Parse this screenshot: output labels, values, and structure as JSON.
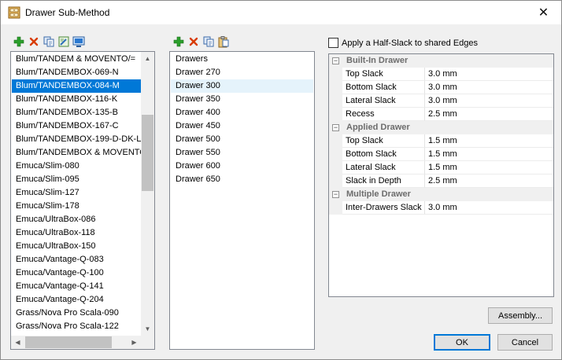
{
  "window": {
    "title": "Drawer Sub-Method",
    "close_glyph": "✕"
  },
  "icons": {
    "app": "drawer-cabinet-icon",
    "add": "add-icon",
    "delete": "delete-icon",
    "copy": "copy-icon",
    "edit": "edit-icon",
    "preview": "preview-icon",
    "paste": "paste-icon"
  },
  "colors": {
    "selection": "#0078d7",
    "add_green": "#2ca02c",
    "delete_red": "#d83b01"
  },
  "methods": {
    "items": [
      "Blum/TANDEM & MOVENTO/=",
      "Blum/TANDEMBOX-069-N",
      "Blum/TANDEMBOX-084-M",
      "Blum/TANDEMBOX-116-K",
      "Blum/TANDEMBOX-135-B",
      "Blum/TANDEMBOX-167-C",
      "Blum/TANDEMBOX-199-D-DK-L",
      "Blum/TANDEMBOX & MOVENTO",
      "Emuca/Slim-080",
      "Emuca/Slim-095",
      "Emuca/Slim-127",
      "Emuca/Slim-178",
      "Emuca/UltraBox-086",
      "Emuca/UltraBox-118",
      "Emuca/UltraBox-150",
      "Emuca/Vantage-Q-083",
      "Emuca/Vantage-Q-100",
      "Emuca/Vantage-Q-141",
      "Emuca/Vantage-Q-204",
      "Grass/Nova Pro Scala-090",
      "Grass/Nova Pro Scala-122"
    ],
    "selected": "Blum/TANDEMBOX-084-M"
  },
  "drawers": {
    "items": [
      "Drawers",
      "Drawer 270",
      "Drawer 300",
      "Drawer 350",
      "Drawer 400",
      "Drawer 450",
      "Drawer 500",
      "Drawer 550",
      "Drawer 600",
      "Drawer 650"
    ],
    "highlighted": "Drawer 300"
  },
  "half_slack": {
    "label": "Apply a Half-Slack to shared Edges",
    "checked": false
  },
  "properties": {
    "categories": [
      {
        "label": "Built-In Drawer",
        "toggle": "−",
        "rows": [
          {
            "name": "Top Slack",
            "value": "3.0 mm"
          },
          {
            "name": "Bottom Slack",
            "value": "3.0 mm"
          },
          {
            "name": "Lateral Slack",
            "value": "3.0 mm"
          },
          {
            "name": "Recess",
            "value": "2.5 mm"
          }
        ]
      },
      {
        "label": "Applied Drawer",
        "toggle": "−",
        "rows": [
          {
            "name": "Top Slack",
            "value": "1.5 mm"
          },
          {
            "name": "Bottom Slack",
            "value": "1.5 mm"
          },
          {
            "name": "Lateral Slack",
            "value": "1.5 mm"
          },
          {
            "name": "Slack in Depth",
            "value": "2.5 mm"
          }
        ]
      },
      {
        "label": "Multiple Drawer",
        "toggle": "−",
        "rows": [
          {
            "name": "Inter-Drawers Slack",
            "value": "3.0 mm"
          }
        ]
      }
    ]
  },
  "buttons": {
    "assembly": "Assembly...",
    "ok": "OK",
    "cancel": "Cancel"
  },
  "scroll_glyphs": {
    "up": "▲",
    "down": "▼",
    "left": "◀",
    "right": "▶"
  }
}
